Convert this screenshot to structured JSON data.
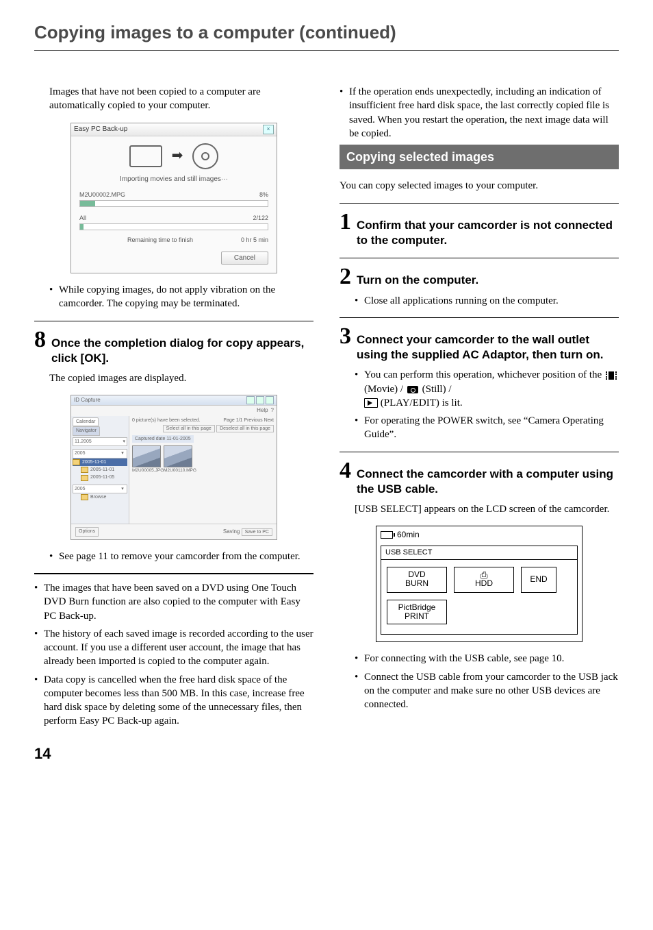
{
  "pageTitle": "Copying images to a computer (continued)",
  "pageNumber": "14",
  "leftCol": {
    "intro": "Images that have not been copied to a computer are automatically copied to your computer.",
    "dlg": {
      "title": "Easy PC Back-up",
      "importing": "Importing movies and still images···",
      "file": "M2U00002.MPG",
      "filePct": "8%",
      "allLabel": "All",
      "allCount": "2/122",
      "remainLabel": "Remaining time to finish",
      "remainValue": "0 hr 5 min",
      "cancel": "Cancel"
    },
    "warnVibration": "While copying images, do not apply vibration on the camcorder. The copying may be terminated.",
    "step8": {
      "num": "8",
      "title": "Once the completion dialog for copy appears, click [OK].",
      "body": "The copied images are displayed."
    },
    "gallery": {
      "windowTitle": "ID Capture",
      "help": "Help",
      "tabCalendar": "Calendar",
      "tabNavigator": "Navigator",
      "yearDate": "11.2005",
      "yearDD": "2005",
      "folder1": "2005-11-01",
      "folder2": "2005-11-01",
      "folder3": "2005-11-05",
      "browse": "Browse",
      "selectedInfo": "0 picture(s) have been selected.",
      "pageLabel": "Page 1/1",
      "prev": "Previous",
      "next": "Next",
      "selectAll": "Select all in this page",
      "deselectAll": "Deselect all in this page",
      "capturedDate": "Captured date 11-01-2005",
      "thumb1": "M2U00005.JPG",
      "thumb2": "M2U00110.MPG",
      "options": "Options",
      "saving": "Saving",
      "copyBtn": "Save to PC"
    },
    "removeNote": "See page 11 to remove your camcorder from the computer.",
    "notes": [
      "The images that have been saved on a DVD using One Touch DVD Burn function are also copied to the computer with Easy PC Back-up.",
      "The history of each saved image is recorded according to the user account. If you use a different user account, the image that has already been imported is copied to the computer again.",
      "Data copy is cancelled when the free hard disk space of the computer becomes less than 500 MB. In this case, increase free hard disk space by deleting some of the unnecessary files, then perform Easy PC Back-up again."
    ]
  },
  "rightCol": {
    "topBullet": "If the operation ends unexpectedly, including an indication of insufficient free hard disk space, the last correctly copied file is saved. When you restart the operation, the next image data will be copied.",
    "sectionTitle": "Copying selected images",
    "sectionIntro": "You can copy selected images to your computer.",
    "step1": {
      "num": "1",
      "title": "Confirm that your camcorder is not connected to the computer."
    },
    "step2": {
      "num": "2",
      "title": "Turn on the computer.",
      "bullet": "Close all applications running on the computer."
    },
    "step3": {
      "num": "3",
      "title": "Connect your camcorder to the wall outlet using the supplied AC Adaptor, then turn on.",
      "bullet1a": "You can perform this operation, whichever position of the ",
      "bullet1b": " (Movie) / ",
      "bullet1c": " (Still) / ",
      "bullet1d": " (PLAY/EDIT) is lit.",
      "bullet2": "For operating the POWER switch, see “Camera Operating Guide”."
    },
    "step4": {
      "num": "4",
      "title": "Connect the camcorder with a computer using the USB cable.",
      "body": "[USB SELECT] appears on the LCD screen of the camcorder.",
      "lcd": {
        "time": "60min",
        "title": "USB SELECT",
        "btnDvd1": "DVD",
        "btnDvd2": "BURN",
        "btnHdd": "HDD",
        "btnEnd": "END",
        "btnPict1": "PictBridge",
        "btnPict2": "PRINT"
      },
      "bullet3": "For connecting with the USB cable, see page 10.",
      "bullet4": "Connect the USB cable from your camcorder to the USB jack on the computer and make sure no other USB devices are connected."
    }
  }
}
